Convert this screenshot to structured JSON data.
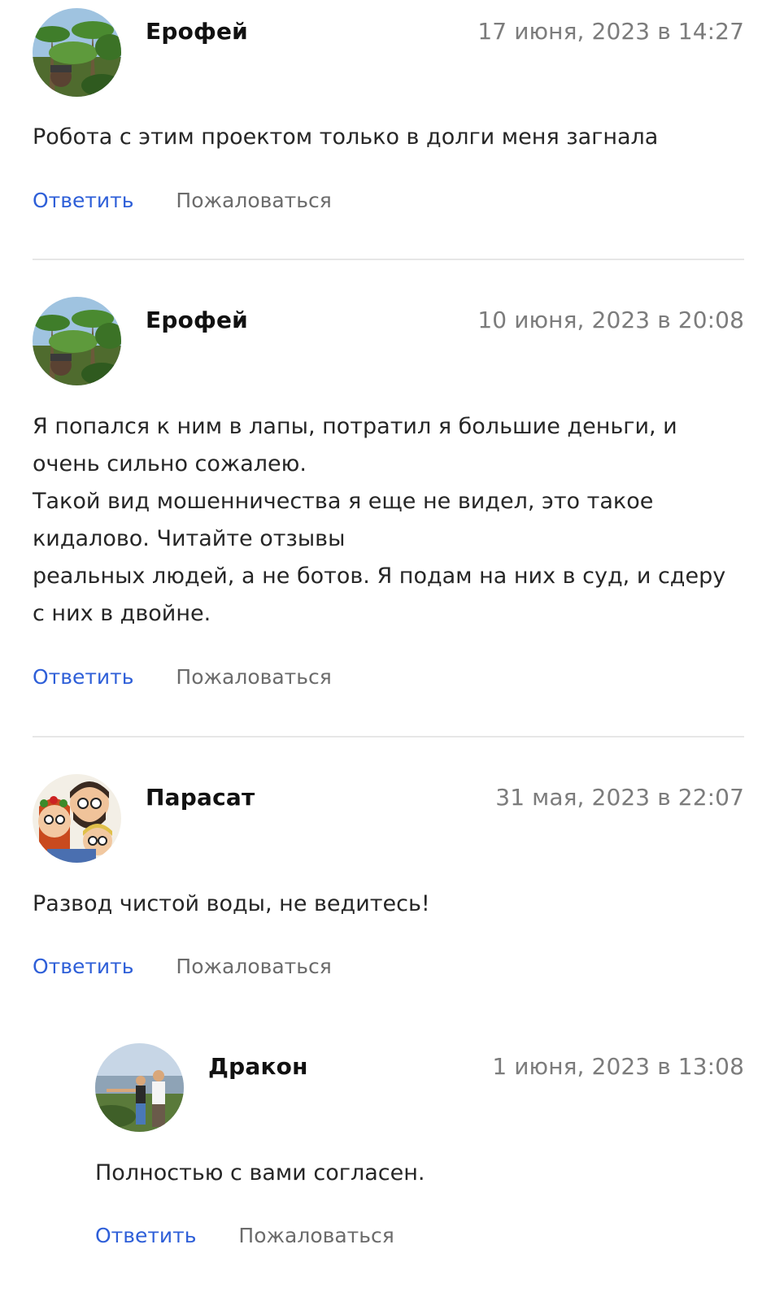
{
  "comments": [
    {
      "author": "Ерофей",
      "date": "17 июня, 2023 в 14:27",
      "avatar": "palm-trees-photo",
      "lines": [
        "Робота с этим проектом только в долги меня загнала"
      ],
      "reply_label": "Ответить",
      "report_label": "Пожаловаться"
    },
    {
      "author": "Ерофей",
      "date": "10 июня, 2023 в 20:08",
      "avatar": "palm-trees-photo",
      "lines": [
        "Я попался к ним в лапы, потратил я большие деньги, и",
        "очень сильно сожалею.",
        "Такой вид мошенничества я еще не видел, это такое",
        "кидалово. Читайте отзывы",
        "реальных людей, а не ботов. Я подам на них в суд, и сдеру",
        "с них в двойне."
      ],
      "reply_label": "Ответить",
      "report_label": "Пожаловаться"
    },
    {
      "author": "Парасат",
      "date": "31 мая, 2023 в 22:07",
      "avatar": "cartoon-family",
      "lines": [
        "Развод чистой воды, не ведитесь!"
      ],
      "reply_label": "Ответить",
      "report_label": "Пожаловаться"
    },
    {
      "author": "Дракон",
      "date": "1 июня, 2023 в 13:08",
      "avatar": "couple-landscape-photo",
      "lines": [
        "Полностью с вами согласен."
      ],
      "reply_label": "Ответить",
      "report_label": "Пожаловаться"
    }
  ],
  "colors": {
    "link": "#2e5fd8",
    "muted": "#7c7c7c",
    "divider": "#e6e6e6"
  }
}
